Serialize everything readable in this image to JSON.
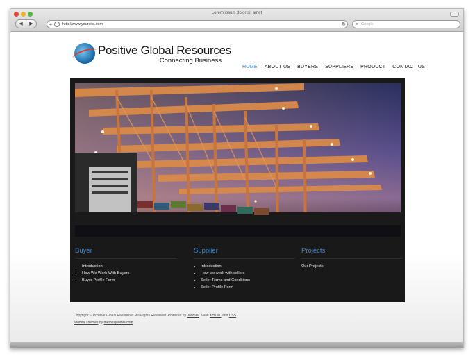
{
  "window": {
    "title": "Lorem ipsum dolor sit amet"
  },
  "toolbar": {
    "back_glyph": "◀",
    "forward_glyph": "▶",
    "add_glyph": "+",
    "url": "http://www.yoursite.com",
    "reload_glyph": "↻",
    "search_placeholder": "Google"
  },
  "logo": {
    "name": "Positive Global Resources",
    "tagline": "Connecting Business"
  },
  "menu": {
    "items": [
      {
        "label": "HOME"
      },
      {
        "label": "ABOUT US"
      },
      {
        "label": "BUYERS"
      },
      {
        "label": "SUPPLIERS"
      },
      {
        "label": "PRODUCT"
      },
      {
        "label": "CONTACT US"
      }
    ],
    "active_color": "#3a7fc0"
  },
  "columns": {
    "buyer": {
      "title": "Buyer",
      "items": [
        "Introduction",
        "How We Work With Buyers",
        "Buyer Profile Form"
      ]
    },
    "supplier": {
      "title": "Supplier",
      "items": [
        "Introduction",
        "How we work with sellers",
        "Seller Terms and Conditions",
        "Seller Profile Form"
      ]
    },
    "projects": {
      "title": "Projects",
      "link": "Our Projects"
    }
  },
  "footer": {
    "copyright": "Copyright © Positive Global Resources. All Rights Reserved. Powered by",
    "joomla": "Joomla!",
    "valid": ". Valid",
    "xhtml": "XHTML",
    "and": "and",
    "css": "CSS",
    "period": ".",
    "themes_label": "Joomla Themes",
    "by": "by",
    "themes_site": "themesjoomla.com"
  },
  "colors": {
    "accent": "#3f86c9",
    "panel": "#191919"
  }
}
